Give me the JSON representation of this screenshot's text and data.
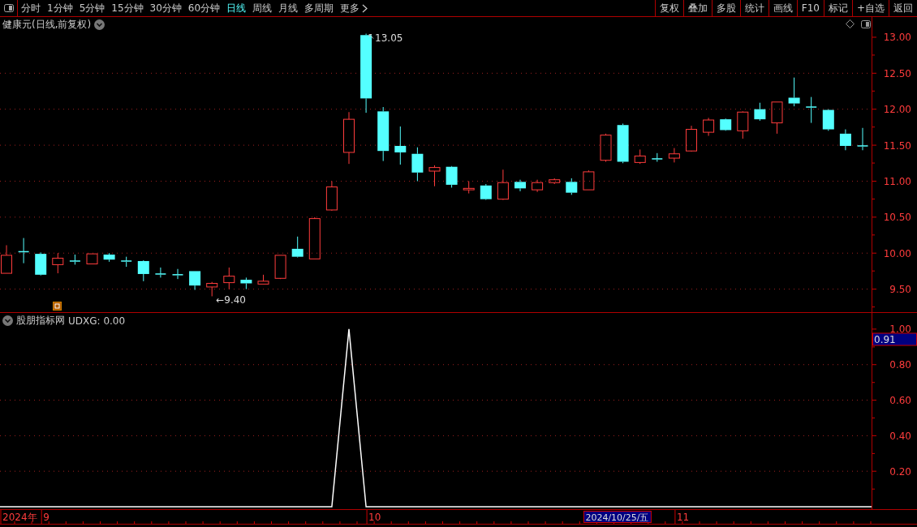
{
  "toolbar": {
    "periods": [
      {
        "label": "分时",
        "selected": false
      },
      {
        "label": "1分钟",
        "selected": false
      },
      {
        "label": "5分钟",
        "selected": false
      },
      {
        "label": "15分钟",
        "selected": false
      },
      {
        "label": "30分钟",
        "selected": false
      },
      {
        "label": "60分钟",
        "selected": false
      },
      {
        "label": "日线",
        "selected": true
      },
      {
        "label": "周线",
        "selected": false
      },
      {
        "label": "月线",
        "selected": false
      },
      {
        "label": "多周期",
        "selected": false
      }
    ],
    "more": "更多",
    "actions": [
      "复权",
      "叠加",
      "多股",
      "统计",
      "画线",
      "F10",
      "标记",
      "+自选",
      "返回"
    ]
  },
  "price_panel": {
    "title": "健康元(日线,前复权)",
    "chart_data": {
      "type": "candlestick",
      "grid": true,
      "ohlc": [
        [
          9.72,
          10.11,
          9.72,
          9.97
        ],
        [
          10.02,
          10.21,
          9.86,
          10.01
        ],
        [
          9.99,
          10.01,
          9.69,
          9.7
        ],
        [
          9.84,
          10.0,
          9.72,
          9.93
        ],
        [
          9.89,
          9.98,
          9.84,
          9.88
        ],
        [
          9.85,
          9.99,
          9.85,
          9.99
        ],
        [
          9.98,
          10.0,
          9.88,
          9.91
        ],
        [
          9.89,
          9.95,
          9.81,
          9.88
        ],
        [
          9.89,
          9.9,
          9.61,
          9.71
        ],
        [
          9.71,
          9.8,
          9.66,
          9.7
        ],
        [
          9.7,
          9.78,
          9.64,
          9.69
        ],
        [
          9.75,
          9.75,
          9.49,
          9.55
        ],
        [
          9.53,
          9.6,
          9.4,
          9.58
        ],
        [
          9.59,
          9.8,
          9.5,
          9.68
        ],
        [
          9.63,
          9.66,
          9.5,
          9.58
        ],
        [
          9.57,
          9.7,
          9.57,
          9.61
        ],
        [
          9.65,
          9.97,
          9.64,
          9.97
        ],
        [
          10.06,
          10.23,
          9.94,
          9.95
        ],
        [
          9.92,
          10.5,
          9.92,
          10.48
        ],
        [
          10.6,
          11.0,
          10.59,
          10.92
        ],
        [
          11.4,
          11.96,
          11.24,
          11.86
        ],
        [
          13.03,
          13.05,
          11.95,
          12.15
        ],
        [
          11.97,
          12.03,
          11.28,
          11.42
        ],
        [
          11.49,
          11.76,
          11.23,
          11.4
        ],
        [
          11.38,
          11.47,
          11.0,
          11.12
        ],
        [
          11.14,
          11.22,
          10.93,
          11.19
        ],
        [
          11.2,
          11.21,
          10.91,
          10.95
        ],
        [
          10.88,
          11.0,
          10.83,
          10.9
        ],
        [
          10.94,
          10.96,
          10.74,
          10.75
        ],
        [
          10.75,
          11.16,
          10.74,
          10.98
        ],
        [
          10.99,
          11.02,
          10.86,
          10.9
        ],
        [
          10.88,
          11.02,
          10.85,
          10.98
        ],
        [
          10.98,
          11.04,
          10.96,
          11.02
        ],
        [
          10.99,
          11.04,
          10.81,
          10.84
        ],
        [
          10.88,
          11.15,
          10.88,
          11.13
        ],
        [
          11.29,
          11.66,
          11.27,
          11.64
        ],
        [
          11.78,
          11.8,
          11.25,
          11.27
        ],
        [
          11.26,
          11.44,
          11.24,
          11.35
        ],
        [
          11.31,
          11.39,
          11.27,
          11.3
        ],
        [
          11.32,
          11.46,
          11.26,
          11.38
        ],
        [
          11.42,
          11.77,
          11.41,
          11.72
        ],
        [
          11.68,
          11.88,
          11.63,
          11.85
        ],
        [
          11.86,
          11.87,
          11.7,
          11.71
        ],
        [
          11.7,
          11.97,
          11.59,
          11.96
        ],
        [
          12.0,
          12.09,
          11.84,
          11.86
        ],
        [
          11.81,
          12.1,
          11.66,
          12.1
        ],
        [
          12.16,
          12.44,
          12.04,
          12.08
        ],
        [
          12.03,
          12.17,
          11.81,
          12.02
        ],
        [
          11.99,
          12.0,
          11.7,
          11.72
        ],
        [
          11.66,
          11.72,
          11.43,
          11.49
        ],
        [
          11.49,
          11.74,
          11.43,
          11.48
        ]
      ],
      "ylim": [
        9.18,
        13.281
      ],
      "yticks": [
        {
          "value": 9.5,
          "label": "9.50"
        },
        {
          "value": 10,
          "label": "10.00"
        },
        {
          "value": 10.5,
          "label": "10.50"
        },
        {
          "value": 11,
          "label": "11.00"
        },
        {
          "value": 11.5,
          "label": "11.50"
        },
        {
          "value": 12,
          "label": "12.00"
        },
        {
          "value": 12.5,
          "label": "12.50"
        },
        {
          "value": 13,
          "label": "13.00"
        }
      ],
      "annotations": [
        "13.05",
        "←9.40"
      ]
    }
  },
  "indicator_panel": {
    "source": "股朋指标网",
    "reading": ": 0.00",
    "cursor_value": "0.91",
    "chart_data": {
      "type": "line",
      "grid": true,
      "series": [
        {
          "name": "UDXG",
          "color": "#ffffff",
          "values": [
            0,
            0,
            0,
            0,
            0,
            0,
            0,
            0,
            0,
            0,
            0,
            0,
            0,
            0,
            0,
            0,
            0,
            0,
            0,
            0,
            1,
            0,
            0,
            0,
            0,
            0,
            0,
            0,
            0,
            0,
            0,
            0,
            0,
            0,
            0,
            0,
            0,
            0,
            0,
            0,
            0,
            0,
            0,
            0,
            0,
            0,
            0,
            0,
            0,
            0,
            0
          ]
        }
      ],
      "ylim": [
        -0.0136,
        1.0909
      ],
      "yticks": [
        {
          "value": 0.2,
          "label": "0.20"
        },
        {
          "value": 0.4,
          "label": "0.40"
        },
        {
          "value": 0.6,
          "label": "0.60"
        },
        {
          "value": 0.8,
          "label": "0.80"
        },
        {
          "value": 1,
          "label": "1.00"
        }
      ]
    }
  },
  "date_axis": {
    "labels": [
      "2024年",
      "9",
      "10",
      "11"
    ],
    "cursor_date": "2024/10/25/五"
  }
}
